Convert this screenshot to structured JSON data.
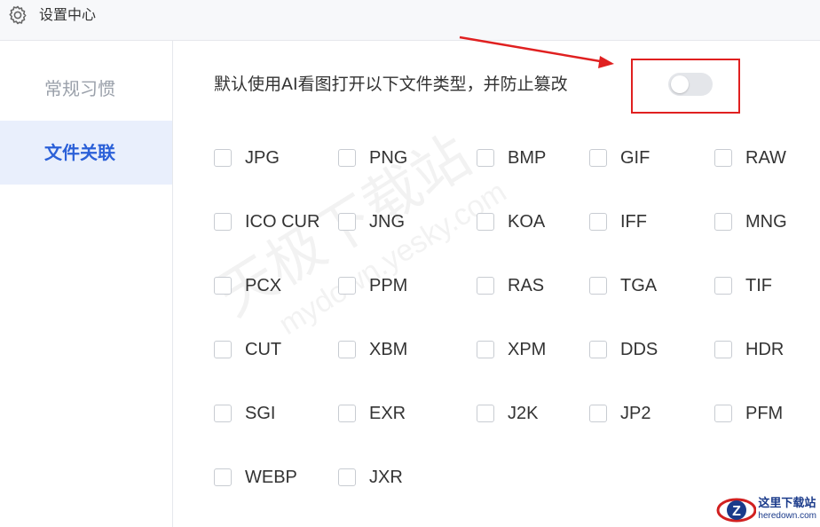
{
  "window": {
    "title": "设置中心",
    "icon": "gear-icon"
  },
  "sidebar": {
    "items": [
      {
        "label": "常规习惯",
        "active": false
      },
      {
        "label": "文件关联",
        "active": true
      }
    ]
  },
  "main": {
    "description": "默认使用AI看图打开以下文件类型，并防止篡改",
    "toggle_on": false,
    "file_types": [
      {
        "label": "JPG",
        "checked": false
      },
      {
        "label": "PNG",
        "checked": false
      },
      {
        "label": "BMP",
        "checked": false
      },
      {
        "label": "GIF",
        "checked": false
      },
      {
        "label": "RAW",
        "checked": false
      },
      {
        "label": "ICO CUR",
        "checked": false
      },
      {
        "label": "JNG",
        "checked": false
      },
      {
        "label": "KOA",
        "checked": false
      },
      {
        "label": "IFF",
        "checked": false
      },
      {
        "label": "MNG",
        "checked": false
      },
      {
        "label": "PCX",
        "checked": false
      },
      {
        "label": "PPM",
        "checked": false
      },
      {
        "label": "RAS",
        "checked": false
      },
      {
        "label": "TGA",
        "checked": false
      },
      {
        "label": "TIF",
        "checked": false
      },
      {
        "label": "CUT",
        "checked": false
      },
      {
        "label": "XBM",
        "checked": false
      },
      {
        "label": "XPM",
        "checked": false
      },
      {
        "label": "DDS",
        "checked": false
      },
      {
        "label": "HDR",
        "checked": false
      },
      {
        "label": "SGI",
        "checked": false
      },
      {
        "label": "EXR",
        "checked": false
      },
      {
        "label": "J2K",
        "checked": false
      },
      {
        "label": "JP2",
        "checked": false
      },
      {
        "label": "PFM",
        "checked": false
      },
      {
        "label": "WEBP",
        "checked": false
      },
      {
        "label": "JXR",
        "checked": false
      }
    ]
  },
  "annotation": {
    "highlight_color": "#e02020"
  },
  "watermark": {
    "cn": "天极下载站",
    "en": "mydown.yesky.com"
  },
  "logo": {
    "cn": "这里下载站",
    "en": "heredown.com"
  }
}
